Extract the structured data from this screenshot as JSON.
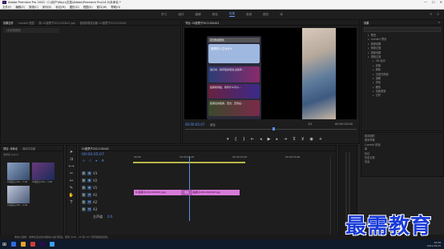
{
  "window": {
    "title": "Adobe Premiere Pro 2020 - C:\\用户\\Kbyu\\文档\\Adobe\\Premiere Pro\\14.0\\未命名 *",
    "controls": [
      "—",
      "☐",
      "✕"
    ]
  },
  "menu": [
    "文件(F)",
    "编辑(E)",
    "剪辑(C)",
    "序列(S)",
    "标记(M)",
    "图形(G)",
    "视图(V)",
    "窗口(W)",
    "帮助(H)"
  ],
  "workspaces": {
    "items": [
      "学习",
      "组件",
      "编辑",
      "颜色",
      "效果",
      "音频",
      "图形",
      "库"
    ],
    "active_index": 4
  },
  "source_panel": {
    "tabs": [
      "效果控件",
      "Lumetri 范围",
      "源: 01股票子2011100441.jpg",
      "音频剪辑混合器: 01股票子2011100441"
    ],
    "subheader": "（无剪辑选择）"
  },
  "program": {
    "tab": "节目: 01股票子2011100441",
    "timecode_left": "00:00:05:07",
    "fit": "适合",
    "quality": "1/2",
    "timecode_right": "00:00:10:00",
    "phone_header": "配置数据更新",
    "phone_title": "股票的人生为什么",
    "notifications": [
      "暑日中，我有很多想说,这些年...",
      "股票我到股，我有什么可以...",
      "股票后的股票，回去，直到后..."
    ]
  },
  "project_panel": {
    "tabs": [
      "项目: 未命名",
      "媒体浏览器"
    ],
    "file": "未命名.prproj",
    "items": [
      {
        "name": "01股票子201...",
        "duration": "5:00"
      },
      {
        "name": "01股票子201...",
        "duration": "5:00"
      },
      {
        "name": "01股票子201...",
        "duration": "5:00"
      }
    ]
  },
  "timeline": {
    "tab": "01股票子2011100441",
    "timecode": "00:00:05:07",
    "ruler": [
      "00:00",
      "00:00:05:00",
      "00:00:10:00",
      "00:00:15:00"
    ],
    "tracks": [
      "V3",
      "V2",
      "V1",
      "A1",
      "A2",
      "A3",
      "主声道"
    ],
    "master_value": "0.0",
    "clips": [
      "01股票子2011100441.jpg",
      "01股票子2011100442.jpg"
    ],
    "transition": "交叉"
  },
  "effects_panel": {
    "title": "效果",
    "tree": [
      "预设",
      "Lumetri 预设",
      "音频效果",
      "音频过渡",
      "视频效果",
      "视频过渡",
      "3D 运动",
      "划像",
      "擦除",
      "沉浸式视频",
      "溶解",
      "滑动",
      "缩放",
      "页面剥落",
      "过时"
    ],
    "sections": [
      "基本图形",
      "基本声音",
      "Lumetri 颜色",
      "库",
      "标记",
      "历史记录",
      "信息"
    ]
  },
  "status": "单击以选择，或单击空白处并拖动以进行框选。使用 Shift、Alt 和 Ctrl 可获得其他选项。",
  "taskbar": {
    "time": "16:58",
    "date": "2021/10/15",
    "icon_colors": [
      "#2d6cdf",
      "#e8a22a",
      "#d13b3b",
      "#2a0a4e",
      "#3aa0e8"
    ]
  },
  "watermark": "最需教育"
}
